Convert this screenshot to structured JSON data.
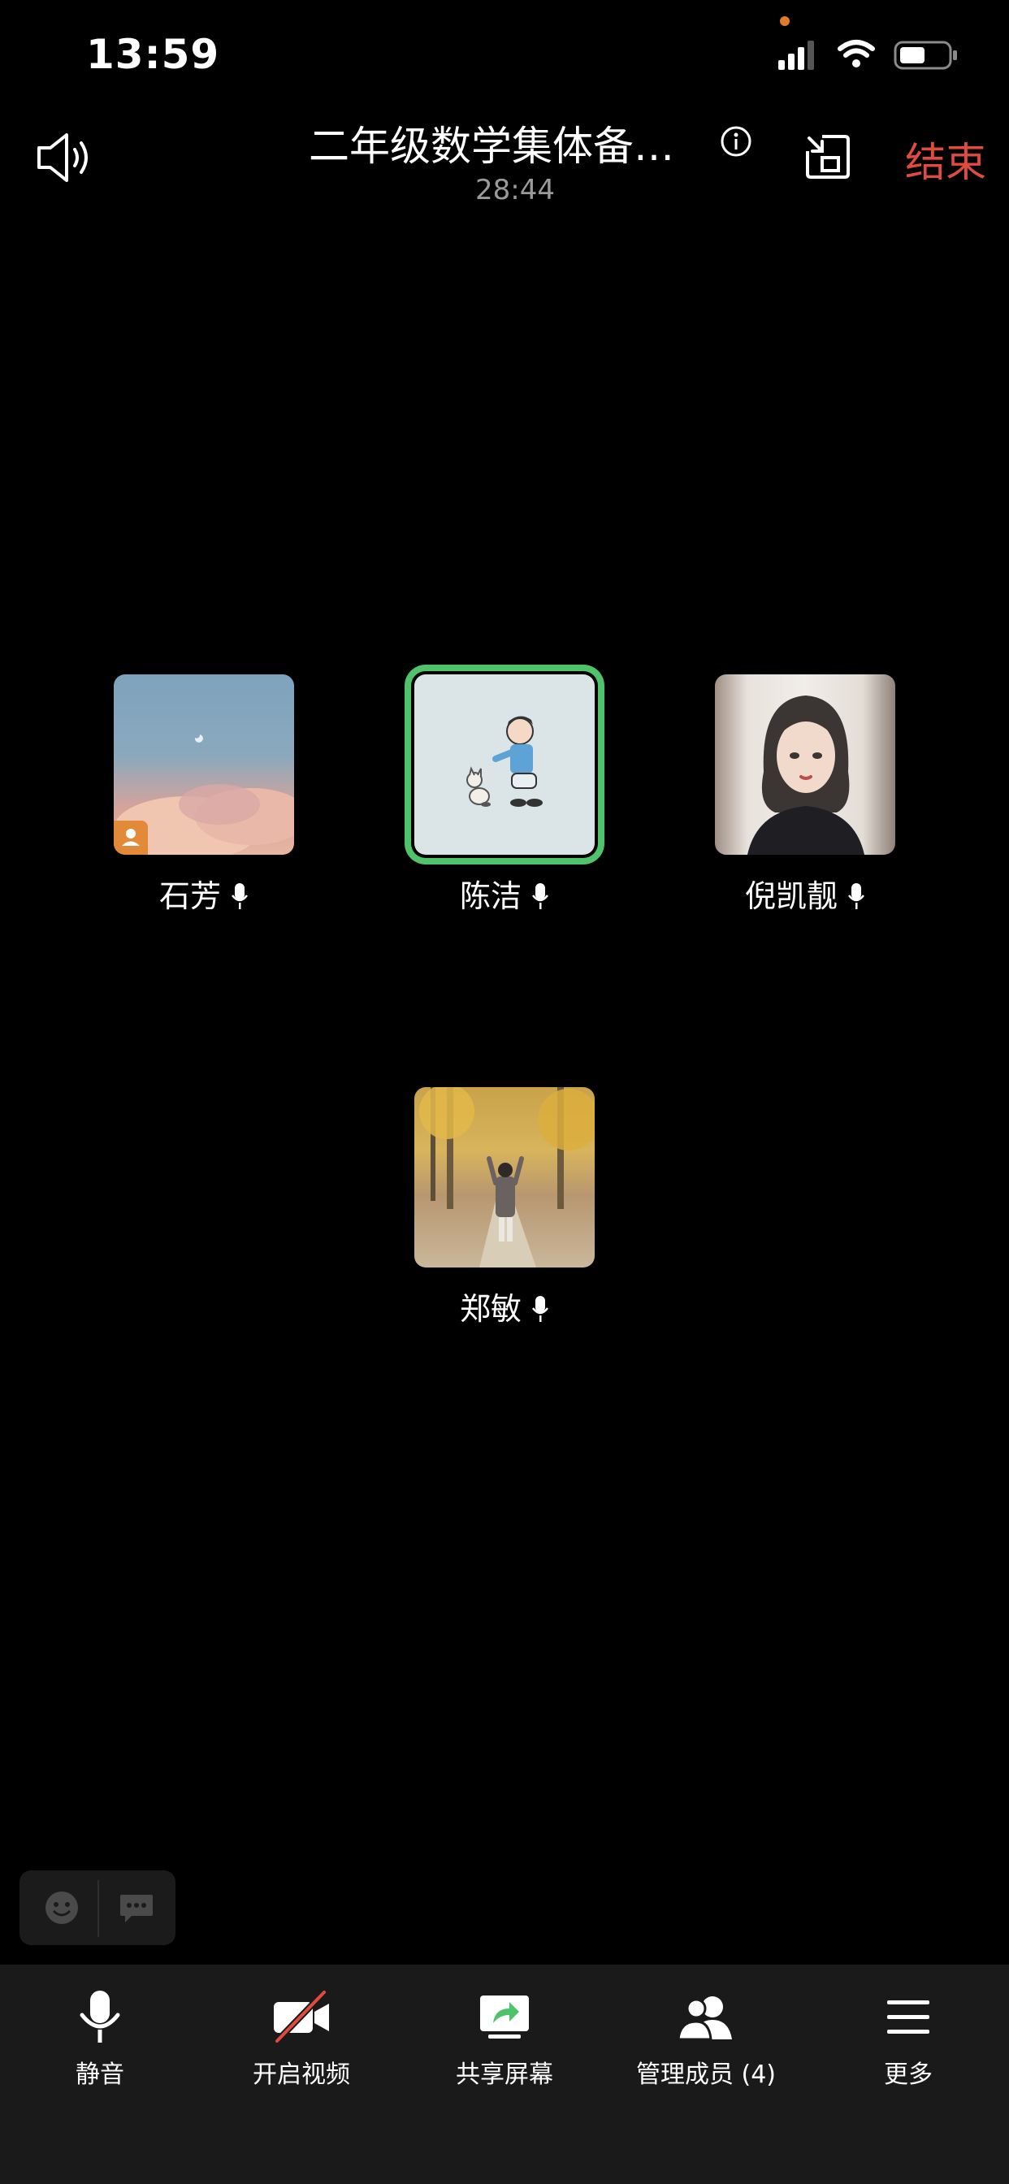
{
  "status_bar": {
    "time": "13:59"
  },
  "header": {
    "title": "二年级数学集体备课...",
    "duration": "28:44",
    "end_label": "结束"
  },
  "participants": [
    {
      "name": "石芳",
      "host": true
    },
    {
      "name": "陈洁",
      "speaking": true
    },
    {
      "name": "倪凯靓"
    },
    {
      "name": "郑敏"
    }
  ],
  "toolbar": {
    "mute_label": "静音",
    "video_label": "开启视频",
    "share_label": "共享屏幕",
    "members_label": "管理成员 (4)",
    "more_label": "更多"
  },
  "colors": {
    "accent_green": "#4ec36b",
    "end_red": "#e04a3f",
    "host_orange": "#e28a37"
  }
}
